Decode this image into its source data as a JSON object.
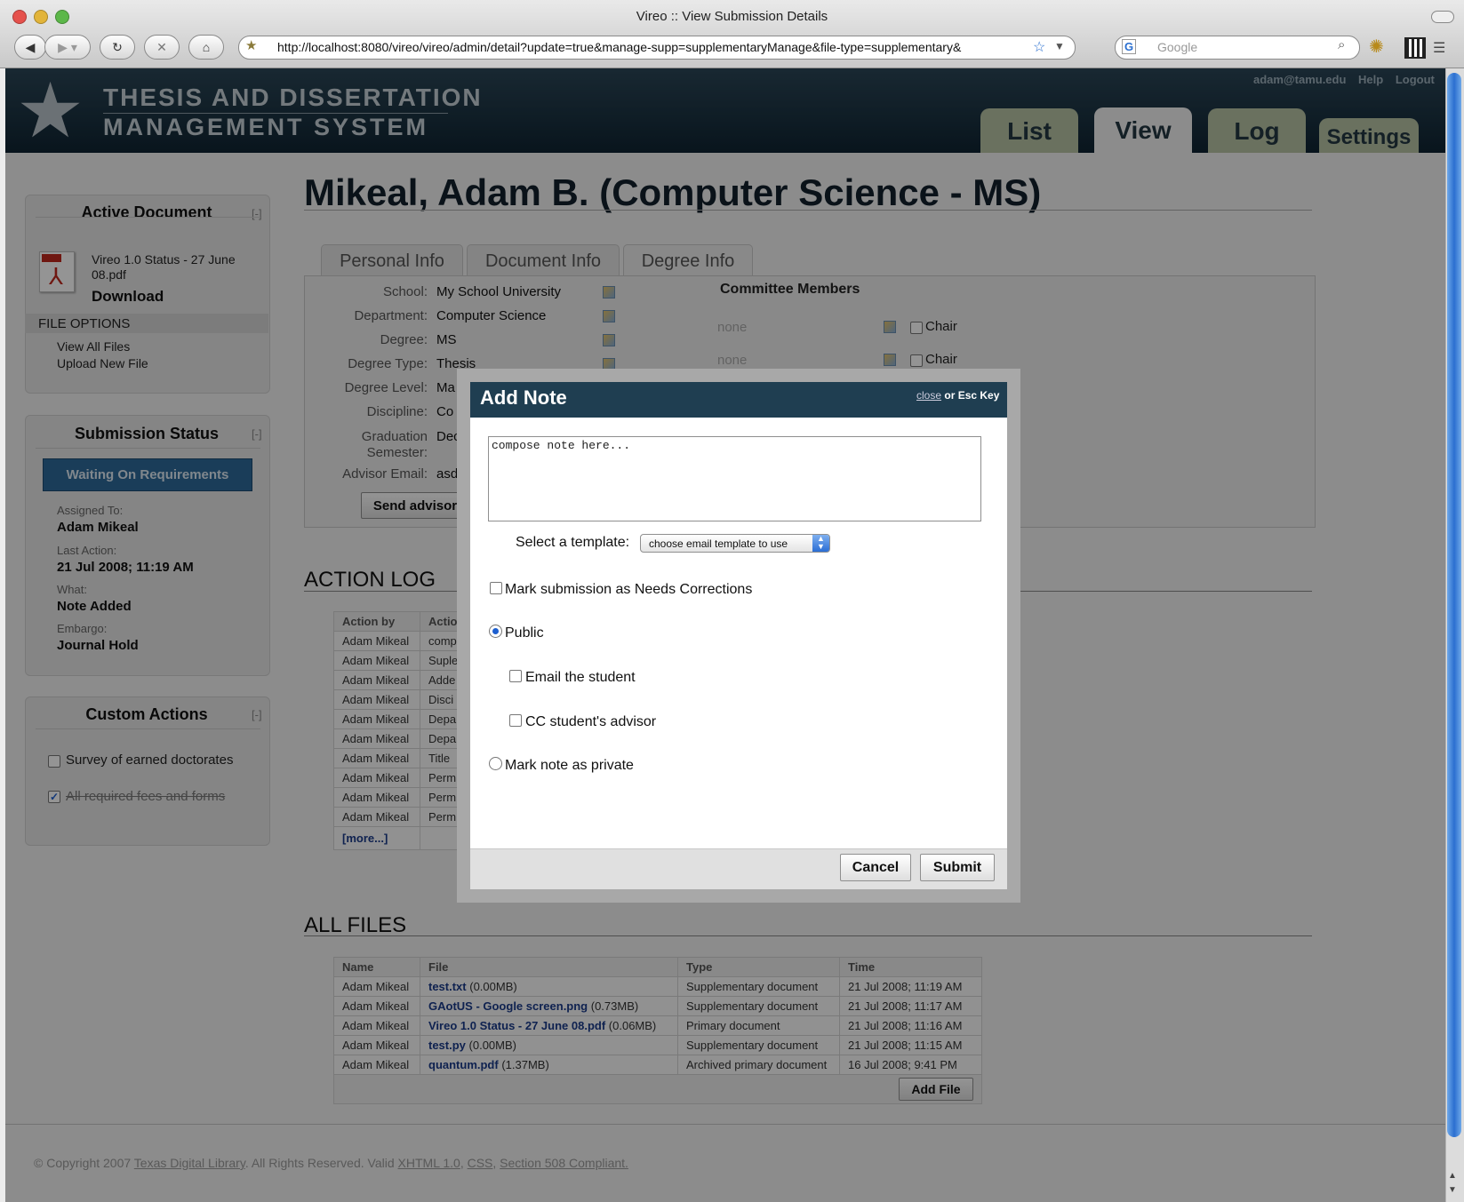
{
  "browser": {
    "window_title": "Vireo :: View Submission Details",
    "url": "http://localhost:8080/vireo/vireo/admin/detail?update=true&manage-supp=supplementaryManage&file-type=supplementary&",
    "search_placeholder": "Google"
  },
  "header": {
    "logo_line1": "THESIS AND DISSERTATION",
    "logo_line2": "MANAGEMENT SYSTEM",
    "user_email": "adam@tamu.edu",
    "help": "Help",
    "logout": "Logout",
    "tabs": [
      {
        "label": "List",
        "active": false
      },
      {
        "label": "View",
        "active": true
      },
      {
        "label": "Log",
        "active": false
      },
      {
        "label": "Settings",
        "active": false
      }
    ]
  },
  "sidebar": {
    "active_document": {
      "title": "Active Document",
      "collapse": "[-]",
      "file_name": "Vireo 1.0 Status - 27 June 08.pdf",
      "download": "Download",
      "file_options_label": "FILE OPTIONS",
      "view_all_files": "View All Files",
      "upload_new_file": "Upload New File"
    },
    "submission_status": {
      "title": "Submission Status",
      "collapse": "[-]",
      "status": "Waiting On Requirements",
      "assigned_to_label": "Assigned To:",
      "assigned_to": "Adam Mikeal",
      "last_action_label": "Last Action:",
      "last_action": "21 Jul 2008; 11:19 AM",
      "what_label": "What:",
      "what": "Note Added",
      "embargo_label": "Embargo:",
      "embargo": "Journal Hold"
    },
    "custom_actions": {
      "title": "Custom Actions",
      "collapse": "[-]",
      "items": [
        {
          "label": "Survey of earned doctorates",
          "checked": false
        },
        {
          "label": "All required fees and forms",
          "checked": true
        }
      ]
    }
  },
  "main": {
    "title": "Mikeal, Adam B. (Computer Science - MS)",
    "tabs": [
      {
        "label": "Personal Info",
        "active": false
      },
      {
        "label": "Document Info",
        "active": false
      },
      {
        "label": "Degree Info",
        "active": true
      }
    ],
    "degree_fields": [
      {
        "label": "School:",
        "value": "My School University"
      },
      {
        "label": "Department:",
        "value": "Computer Science"
      },
      {
        "label": "Degree:",
        "value": "MS"
      },
      {
        "label": "Degree Type:",
        "value": "Thesis"
      },
      {
        "label": "Degree Level:",
        "value": "Ma"
      },
      {
        "label": "Discipline:",
        "value": "Co"
      },
      {
        "label": "Graduation Semester:",
        "value": "Dec"
      },
      {
        "label": "Advisor Email:",
        "value": "asd"
      }
    ],
    "send_advisor_button": "Send advisor",
    "committee": {
      "title": "Committee Members",
      "rows": [
        {
          "name": "none",
          "chair_label": "Chair"
        },
        {
          "name": "none",
          "chair_label": "Chair"
        }
      ]
    },
    "action_log": {
      "title": "ACTION LOG",
      "columns": [
        "Action by",
        "Actio"
      ],
      "rows": [
        [
          "Adam Mikeal",
          "comp"
        ],
        [
          "Adam Mikeal",
          "Suple"
        ],
        [
          "Adam Mikeal",
          "Adde"
        ],
        [
          "Adam Mikeal",
          "Disci"
        ],
        [
          "Adam Mikeal",
          "Depa"
        ],
        [
          "Adam Mikeal",
          "Depa"
        ],
        [
          "Adam Mikeal",
          "Title"
        ],
        [
          "Adam Mikeal",
          "Perm"
        ],
        [
          "Adam Mikeal",
          "Perm"
        ],
        [
          "Adam Mikeal",
          "Perm"
        ]
      ],
      "more": "[more...]"
    },
    "all_files": {
      "title": "ALL FILES",
      "columns": [
        "Name",
        "File",
        "Type",
        "Time"
      ],
      "rows": [
        {
          "name": "Adam Mikeal",
          "file": "test.txt",
          "size": "(0.00MB)",
          "type": "Supplementary document",
          "time": "21 Jul 2008; 11:19 AM"
        },
        {
          "name": "Adam Mikeal",
          "file": "GAotUS - Google screen.png",
          "size": "(0.73MB)",
          "type": "Supplementary document",
          "time": "21 Jul 2008; 11:17 AM"
        },
        {
          "name": "Adam Mikeal",
          "file": "Vireo 1.0 Status - 27 June 08.pdf",
          "size": "(0.06MB)",
          "type": "Primary document",
          "time": "21 Jul 2008; 11:16 AM"
        },
        {
          "name": "Adam Mikeal",
          "file": "test.py",
          "size": "(0.00MB)",
          "type": "Supplementary document",
          "time": "21 Jul 2008; 11:15 AM"
        },
        {
          "name": "Adam Mikeal",
          "file": "quantum.pdf",
          "size": "(1.37MB)",
          "type": "Archived primary document",
          "time": "16 Jul 2008; 9:41 PM"
        }
      ],
      "add_file": "Add File"
    }
  },
  "footer": {
    "copyright": "© Copyright 2007",
    "org": "Texas Digital Library",
    "rights": ". All Rights Reserved. Valid",
    "xhtml": "XHTML 1.0",
    "css": "CSS",
    "section508": "Section 508 Compliant."
  },
  "modal": {
    "title": "Add Note",
    "close_link": "close",
    "close_suffix": "or Esc Key",
    "note_placeholder": "compose note here...",
    "template_label": "Select a template:",
    "template_selected": "choose email template to use",
    "needs_corrections_label": "Mark submission as Needs Corrections",
    "needs_corrections_checked": false,
    "public_label": "Public",
    "public_selected": true,
    "email_student_label": "Email the student",
    "email_student_checked": false,
    "cc_advisor_label": "CC student's advisor",
    "cc_advisor_checked": false,
    "private_label": "Mark note as private",
    "private_selected": false,
    "cancel": "Cancel",
    "submit": "Submit"
  }
}
